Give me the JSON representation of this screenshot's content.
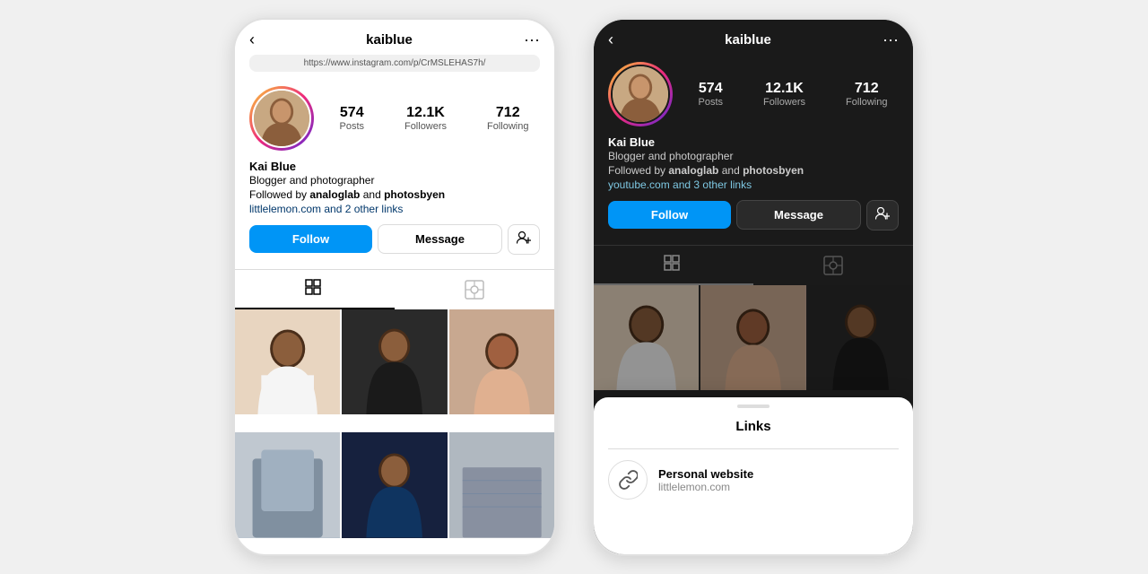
{
  "left_phone": {
    "theme": "light",
    "nav": {
      "back_icon": "‹",
      "username": "kaiblue",
      "more_icon": "···"
    },
    "url_bar": "https://www.instagram.com/p/CrMSLEHAS7h/",
    "profile": {
      "stats": [
        {
          "number": "574",
          "label": "Posts"
        },
        {
          "number": "12.1K",
          "label": "Followers"
        },
        {
          "number": "712",
          "label": "Following"
        }
      ],
      "name": "Kai Blue",
      "description": "Blogger and photographer",
      "followed_by_prefix": "Followed by ",
      "followed_by_user1": "analoglab",
      "followed_by_and": " and ",
      "followed_by_user2": "photosbyen",
      "link": "littlelemon.com",
      "link_suffix": " and 2 other links"
    },
    "buttons": {
      "follow": "Follow",
      "message": "Message",
      "add_friend": "⊕"
    },
    "tabs": {
      "grid_icon": "⊞",
      "tag_icon": "⬜"
    }
  },
  "right_phone": {
    "theme": "dark",
    "nav": {
      "back_icon": "‹",
      "username": "kaiblue",
      "more_icon": "···"
    },
    "profile": {
      "stats": [
        {
          "number": "574",
          "label": "Posts"
        },
        {
          "number": "12.1K",
          "label": "Followers"
        },
        {
          "number": "712",
          "label": "Following"
        }
      ],
      "name": "Kai Blue",
      "description": "Blogger and photographer",
      "followed_by_prefix": "Followed by ",
      "followed_by_user1": "analoglab",
      "followed_by_and": " and ",
      "followed_by_user2": "photosbyen",
      "link": "youtube.com",
      "link_suffix": " and 3 other links"
    },
    "buttons": {
      "follow": "Follow",
      "message": "Message",
      "add_friend": "⊕"
    },
    "tabs": {
      "grid_icon": "⊞",
      "tag_icon": "⬜"
    },
    "bottom_sheet": {
      "handle": "",
      "title": "Links",
      "link": {
        "icon": "↻",
        "title": "Personal website",
        "url": "littlelemon.com"
      }
    }
  }
}
